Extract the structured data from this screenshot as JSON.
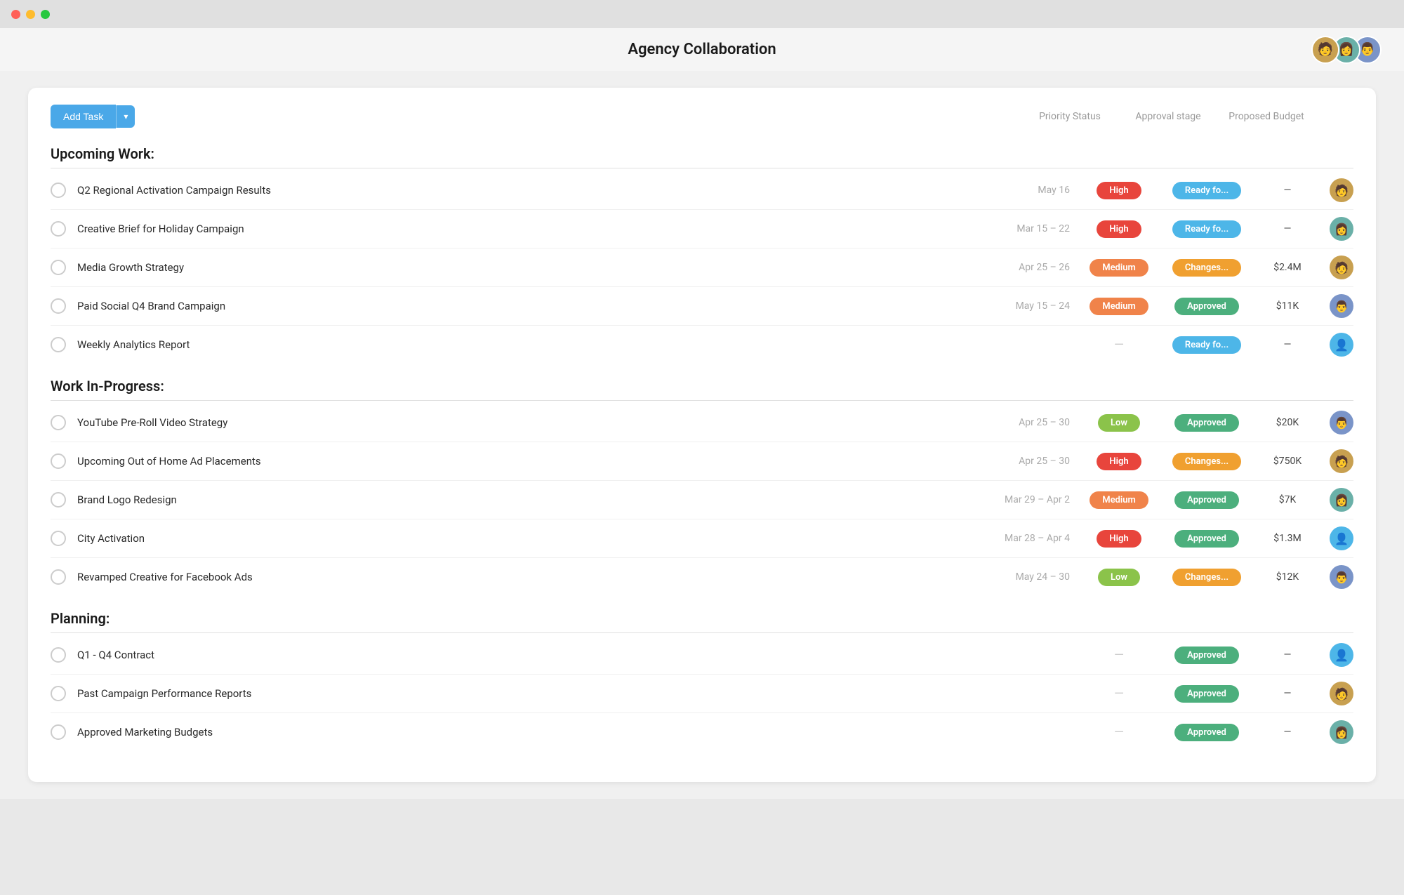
{
  "titlebar": {
    "lights": [
      "red",
      "yellow",
      "green"
    ]
  },
  "header": {
    "title": "Agency Collaboration"
  },
  "avatars": [
    {
      "emoji": "🧑",
      "bg": "#c8a87a"
    },
    {
      "emoji": "👩",
      "bg": "#7abcc8"
    },
    {
      "emoji": "👨",
      "bg": "#7a94c8"
    }
  ],
  "toolbar": {
    "add_task_label": "Add Task"
  },
  "columns": {
    "priority": "Priority Status",
    "approval": "Approval stage",
    "budget": "Proposed Budget"
  },
  "sections": [
    {
      "label": "Upcoming Work:",
      "tasks": [
        {
          "name": "Q2 Regional Activation Campaign Results",
          "date": "May 16",
          "priority": "High",
          "priority_type": "high",
          "approval": "Ready fo...",
          "approval_type": "ready",
          "budget": "—",
          "avatar_emoji": "🧑",
          "avatar_bg": "#c8a050"
        },
        {
          "name": "Creative Brief for Holiday Campaign",
          "date": "Mar 15 – 22",
          "priority": "High",
          "priority_type": "high",
          "approval": "Ready fo...",
          "approval_type": "ready",
          "budget": "—",
          "avatar_emoji": "👩",
          "avatar_bg": "#6ab0a8"
        },
        {
          "name": "Media Growth Strategy",
          "date": "Apr 25 – 26",
          "priority": "Medium",
          "priority_type": "medium",
          "approval": "Changes...",
          "approval_type": "changes",
          "budget": "$2.4M",
          "avatar_emoji": "🧑",
          "avatar_bg": "#c8a050"
        },
        {
          "name": "Paid Social Q4 Brand Campaign",
          "date": "May 15 – 24",
          "priority": "Medium",
          "priority_type": "medium",
          "approval": "Approved",
          "approval_type": "approved",
          "budget": "$11K",
          "avatar_emoji": "👨",
          "avatar_bg": "#7a94c8"
        },
        {
          "name": "Weekly Analytics Report",
          "date": "",
          "priority": "",
          "priority_type": "none",
          "approval": "Ready fo...",
          "approval_type": "ready",
          "budget": "—",
          "avatar_emoji": "👤",
          "avatar_bg": "#4db6e8"
        }
      ]
    },
    {
      "label": "Work In-Progress:",
      "tasks": [
        {
          "name": "YouTube Pre-Roll Video Strategy",
          "date": "Apr 25 – 30",
          "priority": "Low",
          "priority_type": "low",
          "approval": "Approved",
          "approval_type": "approved",
          "budget": "$20K",
          "avatar_emoji": "👨",
          "avatar_bg": "#7a94c8"
        },
        {
          "name": "Upcoming Out of Home Ad Placements",
          "date": "Apr 25 – 30",
          "priority": "High",
          "priority_type": "high",
          "approval": "Changes...",
          "approval_type": "changes",
          "budget": "$750K",
          "avatar_emoji": "🧑",
          "avatar_bg": "#c8a050"
        },
        {
          "name": "Brand Logo Redesign",
          "date": "Mar 29 – Apr 2",
          "priority": "Medium",
          "priority_type": "medium",
          "approval": "Approved",
          "approval_type": "approved",
          "budget": "$7K",
          "avatar_emoji": "👩",
          "avatar_bg": "#6ab0a8"
        },
        {
          "name": "City Activation",
          "date": "Mar 28 – Apr 4",
          "priority": "High",
          "priority_type": "high",
          "approval": "Approved",
          "approval_type": "approved",
          "budget": "$1.3M",
          "avatar_emoji": "👤",
          "avatar_bg": "#4db6e8"
        },
        {
          "name": "Revamped Creative for Facebook Ads",
          "date": "May 24 – 30",
          "priority": "Low",
          "priority_type": "low",
          "approval": "Changes...",
          "approval_type": "changes",
          "budget": "$12K",
          "avatar_emoji": "👨",
          "avatar_bg": "#7a94c8"
        }
      ]
    },
    {
      "label": "Planning:",
      "tasks": [
        {
          "name": "Q1 - Q4 Contract",
          "date": "",
          "priority": "",
          "priority_type": "none",
          "approval": "Approved",
          "approval_type": "approved",
          "budget": "—",
          "avatar_emoji": "👤",
          "avatar_bg": "#4db6e8"
        },
        {
          "name": "Past Campaign Performance Reports",
          "date": "",
          "priority": "",
          "priority_type": "none",
          "approval": "Approved",
          "approval_type": "approved",
          "budget": "—",
          "avatar_emoji": "🧑",
          "avatar_bg": "#c8a050"
        },
        {
          "name": "Approved Marketing Budgets",
          "date": "",
          "priority": "",
          "priority_type": "none",
          "approval": "Approved",
          "approval_type": "approved",
          "budget": "—",
          "avatar_emoji": "👩",
          "avatar_bg": "#6ab0a8"
        }
      ]
    }
  ]
}
